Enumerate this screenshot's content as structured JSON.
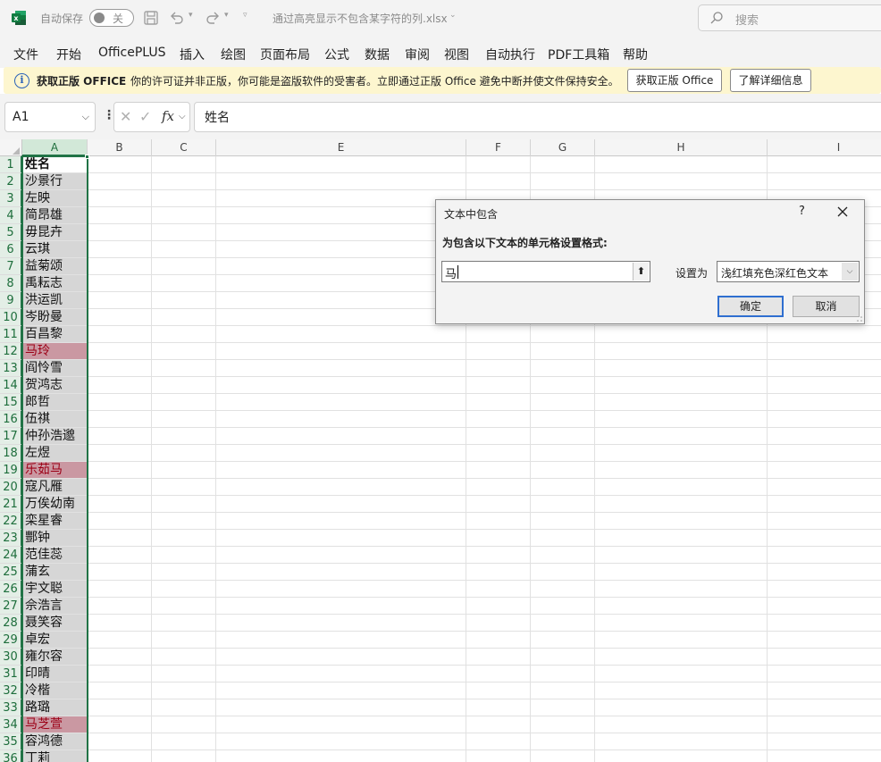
{
  "titlebar": {
    "autosave_label": "自动保存",
    "autosave_state": "关",
    "filename": "通过高亮显示不包含某字符的列.xlsx",
    "search_placeholder": "搜索"
  },
  "menu": [
    "文件",
    "开始",
    "OfficePLUS",
    "插入",
    "绘图",
    "页面布局",
    "公式",
    "数据",
    "审阅",
    "视图",
    "自动执行",
    "PDF工具箱",
    "帮助"
  ],
  "infobar": {
    "title": "获取正版 OFFICE",
    "message": "你的许可证并非正版，你可能是盗版软件的受害者。立即通过正版 Office 避免中断并使文件保持安全。",
    "button_get": "获取正版 Office",
    "button_learn": "了解详细信息"
  },
  "formula_bar": {
    "name_box": "A1",
    "fx": "fx",
    "content": "姓名"
  },
  "columns": [
    "A",
    "B",
    "C",
    "E",
    "F",
    "G",
    "H",
    "I"
  ],
  "rows": [
    "1",
    "2",
    "3",
    "4",
    "5",
    "6",
    "7",
    "8",
    "9",
    "10",
    "11",
    "12",
    "13",
    "14",
    "15",
    "16",
    "17",
    "18",
    "19",
    "20",
    "21",
    "22",
    "23",
    "24",
    "25",
    "26",
    "27",
    "28",
    "29",
    "30",
    "31",
    "32",
    "33",
    "34",
    "35",
    "36"
  ],
  "column_a": [
    "姓名",
    "沙景行",
    "左映",
    "简昂雄",
    "毋昆卉",
    "云琪",
    "益菊颂",
    "禹耘志",
    "洪运凯",
    "岑盼曼",
    "百昌黎",
    "马玲",
    "阎怜雪",
    "贺鸿志",
    "郎哲",
    "伍祺",
    "仲孙浩邈",
    "左煜",
    "乐茹马",
    "寇凡雁",
    "万俟幼南",
    "栾星睿",
    "酆钟",
    "范佳蕊",
    "蒲玄",
    "宇文聪",
    "佘浩言",
    "聂笑容",
    "卓宏",
    "雍尔容",
    "印晴",
    "冷楷",
    "路璐",
    "马芝萱",
    "容鸿德",
    "丁莉"
  ],
  "highlight_rows": [
    12,
    19,
    34
  ],
  "colors": {
    "highlight_fill": "#ca98a2",
    "highlight_text": "#9c0016",
    "selection_fill": "#d6d6d6",
    "excel_green": "#217346"
  },
  "dialog": {
    "title": "文本中包含",
    "help": "?",
    "prompt": "为包含以下文本的单元格设置格式:",
    "input_value": "马",
    "set_label": "设置为",
    "format_option": "浅红填充色深红色文本",
    "ok": "确定",
    "cancel": "取消"
  }
}
